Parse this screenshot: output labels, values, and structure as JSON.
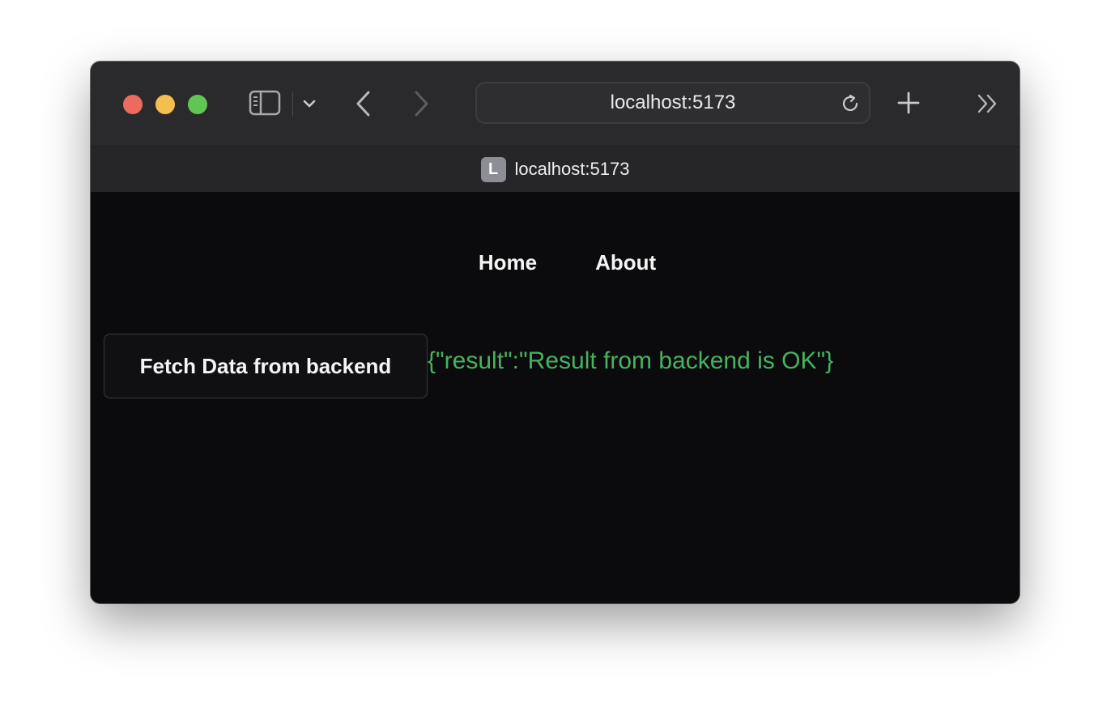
{
  "browser": {
    "address": "localhost:5173",
    "tab": {
      "favicon_letter": "L",
      "title": "localhost:5173"
    },
    "icons": {
      "sidebar": "sidebar-icon",
      "tab_menu": "chevron-down-icon",
      "back": "chevron-left-icon",
      "forward": "chevron-right-icon",
      "reload": "reload-icon",
      "new_tab": "plus-icon",
      "more_tabs": "double-chevron-right-icon"
    }
  },
  "page": {
    "nav": [
      {
        "label": "Home"
      },
      {
        "label": "About"
      }
    ],
    "fetch_button_label": "Fetch Data from backend",
    "result": "{\"result\":\"Result from backend is OK\"}",
    "colors": {
      "background": "#0b0b0d",
      "result_text": "#46b45e"
    }
  }
}
